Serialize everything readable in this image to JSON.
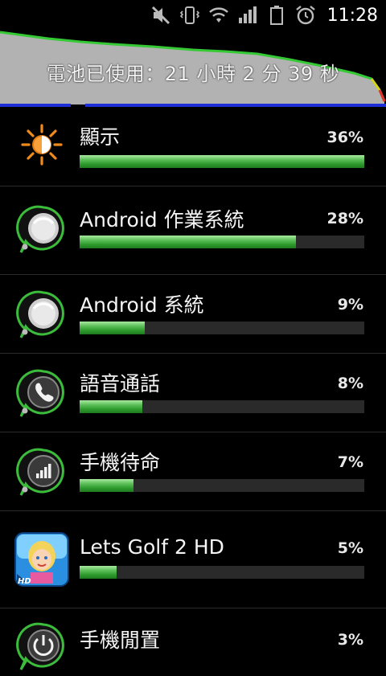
{
  "status_bar": {
    "time": "11:28",
    "icons": [
      "mute-icon",
      "vibrate-icon",
      "wifi-icon",
      "signal-icon",
      "battery-icon",
      "alarm-icon"
    ]
  },
  "battery_summary": {
    "usage_text": "電池已使用：21 小時 2 分 39 秒"
  },
  "usage_items": [
    {
      "label": "顯示",
      "percent_text": "36%",
      "percent": 36,
      "fill_fraction": 1.0,
      "icon": "display-sun-icon"
    },
    {
      "label": "Android 作業系統",
      "percent_text": "28%",
      "percent": 28,
      "fill_fraction": 0.76,
      "icon": "android-os-icon"
    },
    {
      "label": "Android 系統",
      "percent_text": "9%",
      "percent": 9,
      "fill_fraction": 0.23,
      "icon": "android-system-icon"
    },
    {
      "label": "語音通話",
      "percent_text": "8%",
      "percent": 8,
      "fill_fraction": 0.22,
      "icon": "phone-call-icon"
    },
    {
      "label": "手機待命",
      "percent_text": "7%",
      "percent": 7,
      "fill_fraction": 0.19,
      "icon": "cell-standby-icon"
    },
    {
      "label": "Lets Golf 2 HD",
      "percent_text": "5%",
      "percent": 5,
      "fill_fraction": 0.13,
      "icon": "lets-golf-app-icon"
    },
    {
      "label": "手機閒置",
      "percent_text": "3%",
      "percent": 3,
      "fill_fraction": 0.08,
      "icon": "power-idle-icon"
    }
  ],
  "colors": {
    "bar_fill": "#3fae3f",
    "graph_line": "#35c935",
    "graph_fill": "#b5b5b5",
    "blue_line": "#1f2fd8"
  }
}
